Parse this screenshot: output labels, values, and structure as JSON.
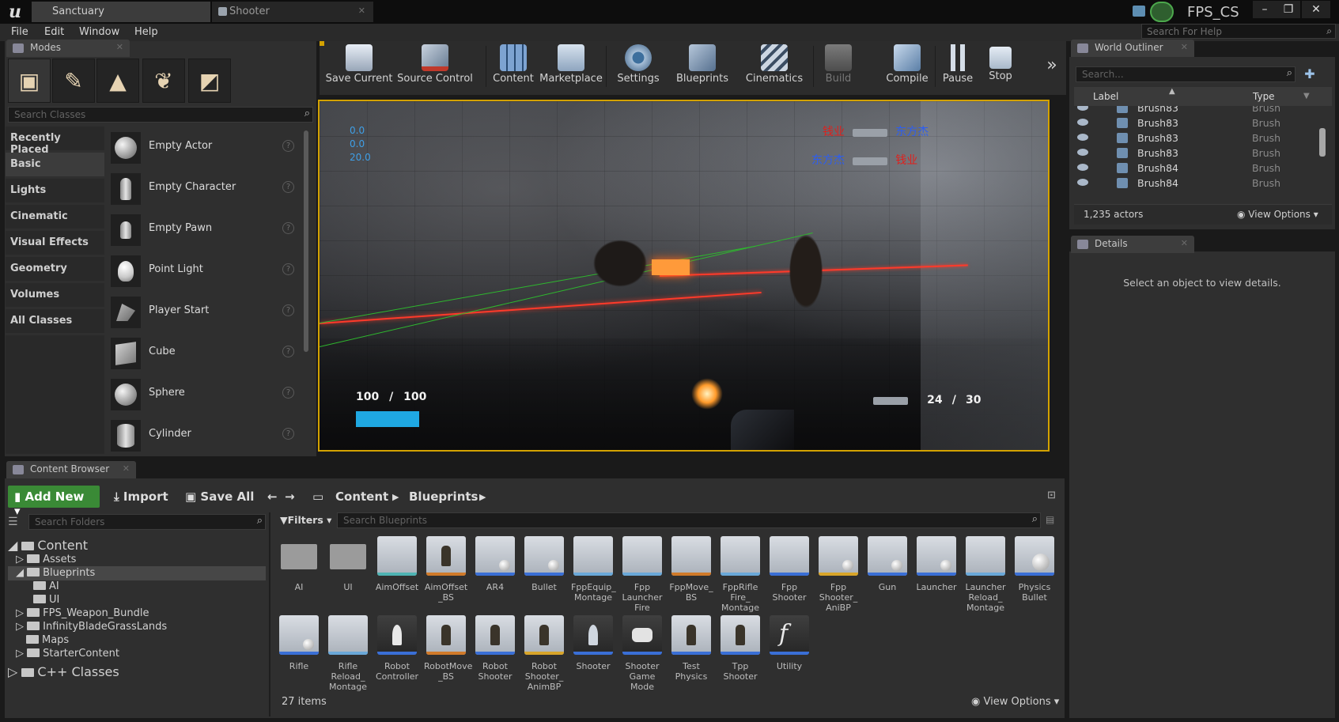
{
  "window": {
    "tabs": [
      "Sanctuary",
      "Shooter"
    ],
    "project_name": "FPS_CS",
    "controls": [
      "–",
      "❐",
      "✕"
    ]
  },
  "menu": [
    "File",
    "Edit",
    "Window",
    "Help"
  ],
  "help_search": {
    "placeholder": "Search For Help"
  },
  "modes": {
    "tab_title": "Modes",
    "search_placeholder": "Search Classes",
    "categories": [
      "Recently Placed",
      "Basic",
      "Lights",
      "Cinematic",
      "Visual Effects",
      "Geometry",
      "Volumes",
      "All Classes"
    ],
    "active_category": "Basic",
    "classes": [
      "Empty Actor",
      "Empty Character",
      "Empty Pawn",
      "Point Light",
      "Player Start",
      "Cube",
      "Sphere",
      "Cylinder"
    ]
  },
  "toolbar": {
    "buttons": [
      "Save Current",
      "Source Control",
      "Content",
      "Marketplace",
      "Settings",
      "Blueprints",
      "Cinematics",
      "Build",
      "Compile",
      "Pause",
      "Stop"
    ],
    "more": "»"
  },
  "viewport": {
    "stats": [
      "0.0",
      "0.0",
      "20.0"
    ],
    "killfeed": [
      {
        "killer": "钱业",
        "victim": "东方杰"
      },
      {
        "killer": "东方杰",
        "victim": "钱业"
      }
    ],
    "health": {
      "current": "100",
      "separator": "/",
      "max": "100",
      "fraction": 1.0
    },
    "ammo": {
      "current": "24",
      "separator": "/",
      "max": "30"
    }
  },
  "world_outliner": {
    "tab_title": "World Outliner",
    "search_placeholder": "Search...",
    "columns": [
      "Label",
      "Type"
    ],
    "rows": [
      {
        "label": "Brush83",
        "type": "Brush"
      },
      {
        "label": "Brush83",
        "type": "Brush"
      },
      {
        "label": "Brush83",
        "type": "Brush"
      },
      {
        "label": "Brush83",
        "type": "Brush"
      },
      {
        "label": "Brush84",
        "type": "Brush"
      },
      {
        "label": "Brush84",
        "type": "Brush"
      }
    ],
    "actor_count": "1,235 actors",
    "view_options": "View Options"
  },
  "details": {
    "tab_title": "Details",
    "empty_message": "Select an object to view details."
  },
  "content_browser": {
    "tab_title": "Content Browser",
    "add_new": "Add New",
    "import": "Import",
    "save_all": "Save All",
    "breadcrumb": [
      "Content",
      "Blueprints"
    ],
    "folder_search_placeholder": "Search Folders",
    "filters": "Filters",
    "asset_search_placeholder": "Search Blueprints",
    "tree": [
      {
        "label": "Content",
        "level": 0
      },
      {
        "label": "Assets",
        "level": 1
      },
      {
        "label": "Blueprints",
        "level": 1
      },
      {
        "label": "AI",
        "level": 2
      },
      {
        "label": "UI",
        "level": 2
      },
      {
        "label": "FPS_Weapon_Bundle",
        "level": 1
      },
      {
        "label": "InfinityBladeGrassLands",
        "level": 1
      },
      {
        "label": "Maps",
        "level": 1
      },
      {
        "label": "StarterContent",
        "level": 1
      },
      {
        "label": "C++ Classes",
        "level": 0
      }
    ],
    "assets": [
      "AI",
      "UI",
      "AimOffset",
      "AimOffset _BS",
      "AR4",
      "Bullet",
      "FppEquip_ Montage",
      "Fpp Launcher Fire",
      "FppMove_ BS",
      "FppRifle Fire_ Montage",
      "Fpp Shooter",
      "Fpp Shooter_ AniBP",
      "Gun",
      "Launcher",
      "Launcher Reload_ Montage",
      "Physics Bullet",
      "Rifle",
      "Rifle Reload_ Montage",
      "Robot Controller",
      "RobotMove _BS",
      "Robot Shooter",
      "Robot Shooter_ AnimBP",
      "Shooter",
      "Shooter Game Mode",
      "Test Physics",
      "Tpp Shooter",
      "Utility"
    ],
    "item_count": "27 items",
    "view_options": "View Options"
  }
}
